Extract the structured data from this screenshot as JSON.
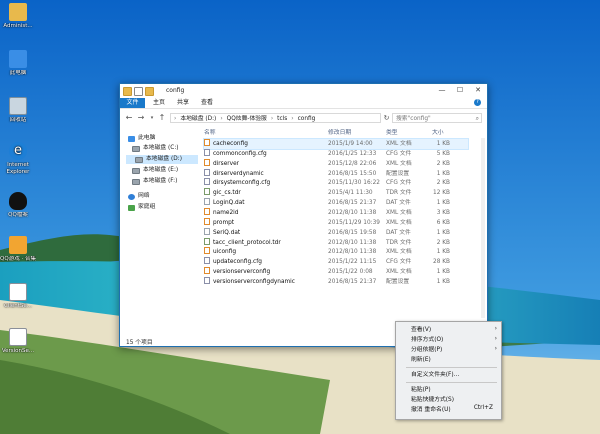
{
  "desktop": {
    "icons": [
      {
        "label": "Administ...",
        "icon": "user-folder-icon"
      },
      {
        "label": "此电脑",
        "icon": "computer-icon"
      },
      {
        "label": "回收站",
        "icon": "recycle-bin-icon"
      },
      {
        "label": "Internet Explorer",
        "icon": "internet-explorer-icon"
      },
      {
        "label": "QQ檔案",
        "icon": "qq-penguin-icon"
      },
      {
        "label": "QQ游戏 · 合集",
        "icon": "qq-game-icon"
      },
      {
        "label": "ClientSe...",
        "icon": "document-icon"
      },
      {
        "label": "VersionSe...",
        "icon": "document-icon"
      }
    ]
  },
  "window": {
    "title": "config",
    "controls": {
      "minimize": "—",
      "maximize": "☐",
      "close": "✕"
    },
    "ribbon_tabs": [
      "文件",
      "主页",
      "共享",
      "查看"
    ],
    "ribbon_help": "?",
    "address_parts": [
      "本地磁盘 (D:)",
      "QQ炫舞-体验服",
      "tcls",
      "config"
    ],
    "search_placeholder": "搜索\"config\"",
    "nav": [
      {
        "label": "此电脑",
        "icon": "computer-icon"
      },
      {
        "label": "本地磁盘 (C:)",
        "icon": "drive-icon"
      },
      {
        "label": "本地磁盘 (D:)",
        "icon": "drive-icon",
        "selected": true
      },
      {
        "label": "本地磁盘 (E:)",
        "icon": "drive-icon"
      },
      {
        "label": "本地磁盘 (F:)",
        "icon": "drive-icon"
      },
      {
        "label": "网络",
        "icon": "network-icon"
      },
      {
        "label": "家庭组",
        "icon": "homegroup-icon"
      }
    ],
    "columns": {
      "name": "名称",
      "date": "修改日期",
      "type": "类型",
      "size": "大小"
    },
    "files": [
      {
        "name": "cacheconfig",
        "date": "2015/1/9 14:00",
        "type": "XML 文档",
        "size": "1 KB",
        "kind": "xml"
      },
      {
        "name": "commonconfig.cfg",
        "date": "2016/1/25 12:33",
        "type": "CFG 文件",
        "size": "5 KB",
        "kind": "cfg"
      },
      {
        "name": "dirserver",
        "date": "2015/12/8 22:06",
        "type": "XML 文档",
        "size": "2 KB",
        "kind": "xml"
      },
      {
        "name": "dirserverdynamic",
        "date": "2016/8/15 15:50",
        "type": "配置设置",
        "size": "1 KB",
        "kind": "cfg"
      },
      {
        "name": "dirsystemconfig.cfg",
        "date": "2015/11/30 16:22",
        "type": "CFG 文件",
        "size": "2 KB",
        "kind": "cfg"
      },
      {
        "name": "gic_cs.tdr",
        "date": "2015/4/1 11:30",
        "type": "TDR 文件",
        "size": "12 KB",
        "kind": "tdr"
      },
      {
        "name": "LoginQ.dat",
        "date": "2016/8/15 21:37",
        "type": "DAT 文件",
        "size": "1 KB",
        "kind": "dat"
      },
      {
        "name": "name2id",
        "date": "2012/8/10 11:38",
        "type": "XML 文档",
        "size": "3 KB",
        "kind": "xml"
      },
      {
        "name": "prompt",
        "date": "2015/11/29 10:39",
        "type": "XML 文档",
        "size": "6 KB",
        "kind": "xml"
      },
      {
        "name": "SeriQ.dat",
        "date": "2016/8/15 19:58",
        "type": "DAT 文件",
        "size": "1 KB",
        "kind": "dat"
      },
      {
        "name": "tacc_client_protocol.tdr",
        "date": "2012/8/10 11:38",
        "type": "TDR 文件",
        "size": "2 KB",
        "kind": "tdr"
      },
      {
        "name": "uiconfig",
        "date": "2012/8/10 11:38",
        "type": "XML 文档",
        "size": "1 KB",
        "kind": "xml"
      },
      {
        "name": "updateconfig.cfg",
        "date": "2015/1/22 11:15",
        "type": "CFG 文件",
        "size": "28 KB",
        "kind": "cfg"
      },
      {
        "name": "versionserverconfig",
        "date": "2015/1/22 0:08",
        "type": "XML 文档",
        "size": "1 KB",
        "kind": "xml"
      },
      {
        "name": "versionserverconfigdynamic",
        "date": "2016/8/15 21:37",
        "type": "配置设置",
        "size": "1 KB",
        "kind": "cfg"
      }
    ],
    "status": "15 个项目"
  },
  "context_menu": {
    "items": [
      {
        "label": "查看(V)",
        "submenu": true
      },
      {
        "label": "排序方式(O)",
        "submenu": true
      },
      {
        "label": "分组依据(P)",
        "submenu": true
      },
      {
        "label": "刷新(E)"
      },
      {
        "label": "自定义文件夹(F)..."
      },
      {
        "label": "粘贴(P)"
      },
      {
        "label": "粘贴快捷方式(S)"
      },
      {
        "label": "撤消 重命名(U)",
        "shortcut": "Ctrl+Z"
      }
    ]
  },
  "colors": {
    "accent": "#1979ca",
    "selection": "#cce8ff"
  }
}
